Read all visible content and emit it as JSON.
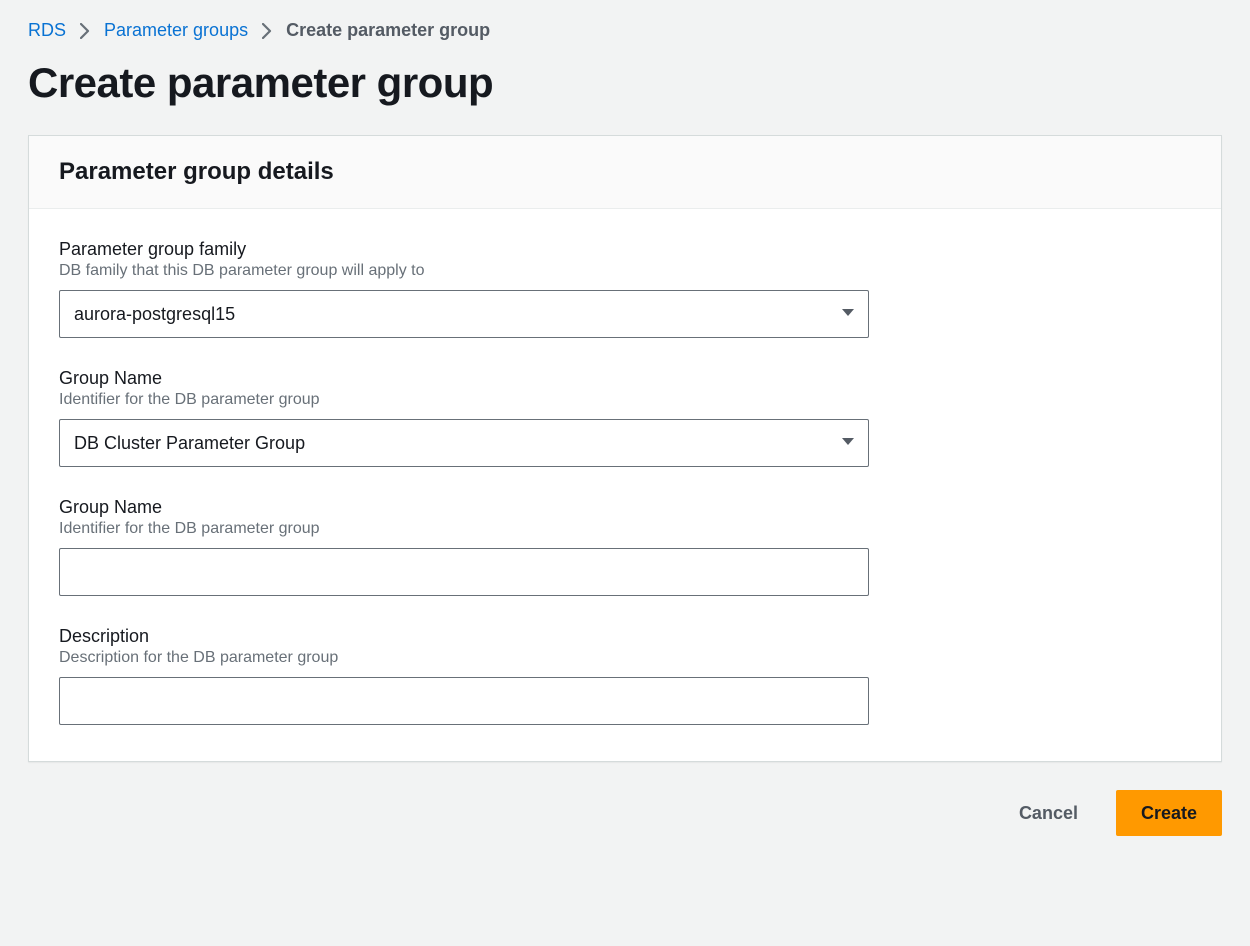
{
  "breadcrumb": {
    "items": [
      {
        "label": "RDS",
        "link": true
      },
      {
        "label": "Parameter groups",
        "link": true
      },
      {
        "label": "Create parameter group",
        "link": false
      }
    ]
  },
  "page": {
    "title": "Create parameter group"
  },
  "panel": {
    "title": "Parameter group details"
  },
  "fields": {
    "family": {
      "label": "Parameter group family",
      "hint": "DB family that this DB parameter group will apply to",
      "value": "aurora-postgresql15"
    },
    "type": {
      "label": "Group Name",
      "hint": "Identifier for the DB parameter group",
      "value": "DB Cluster Parameter Group"
    },
    "name": {
      "label": "Group Name",
      "hint": "Identifier for the DB parameter group",
      "value": ""
    },
    "description": {
      "label": "Description",
      "hint": "Description for the DB parameter group",
      "value": ""
    }
  },
  "actions": {
    "cancel": "Cancel",
    "create": "Create"
  }
}
